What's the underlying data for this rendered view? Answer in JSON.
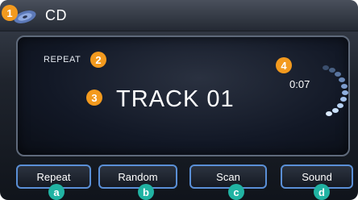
{
  "header": {
    "title": "CD"
  },
  "display": {
    "mode_label": "REPEAT",
    "track_label": "TRACK 01",
    "elapsed_time": "0:07"
  },
  "buttons": [
    {
      "label": "Repeat"
    },
    {
      "label": "Random"
    },
    {
      "label": "Scan"
    },
    {
      "label": "Sound"
    }
  ],
  "callouts": {
    "numbers": [
      "1",
      "2",
      "3",
      "4"
    ],
    "letters": [
      "a",
      "b",
      "c",
      "d"
    ]
  },
  "colors": {
    "callout_number": "#f39a1e",
    "callout_letter": "#21b3a3",
    "button_border": "#5a8fd6"
  }
}
